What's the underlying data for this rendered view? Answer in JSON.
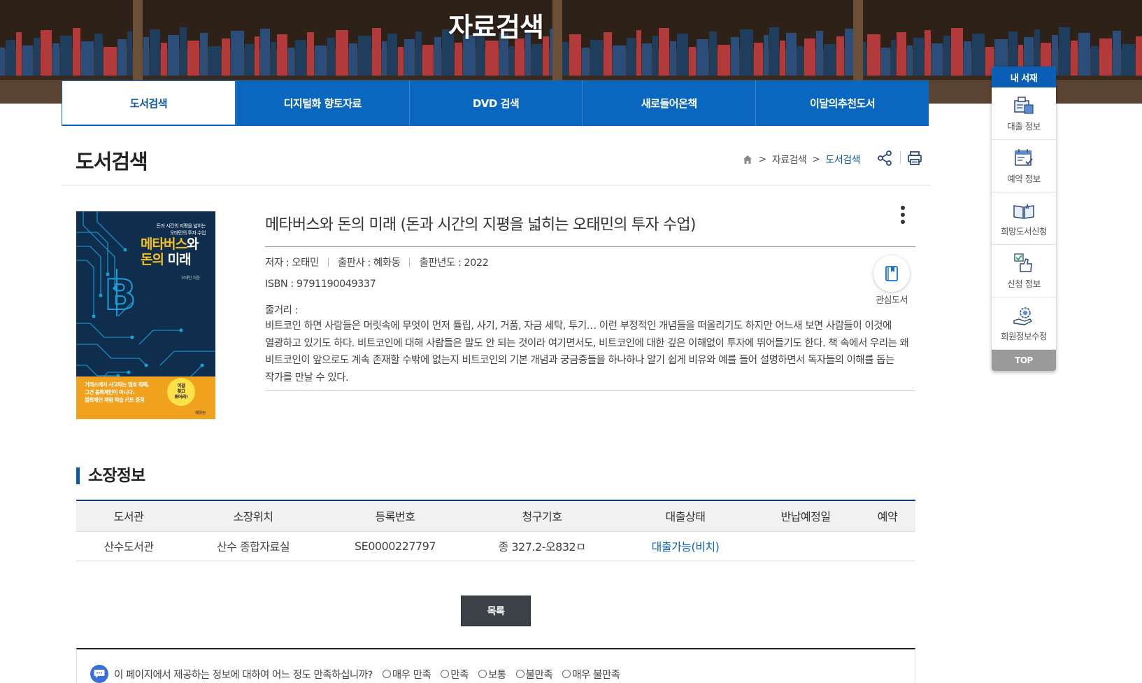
{
  "header": {
    "title": "자료검색"
  },
  "tabs": [
    {
      "label": "도서검색",
      "active": true
    },
    {
      "label": "디지털화 향토자료",
      "active": false
    },
    {
      "label": "DVD 검색",
      "active": false
    },
    {
      "label": "새로들어온책",
      "active": false
    },
    {
      "label": "이달의추천도서",
      "active": false
    }
  ],
  "page": {
    "title": "도서검색",
    "breadcrumb": [
      "자료검색",
      "도서검색"
    ],
    "breadcrumb_sep": ">"
  },
  "book": {
    "title": "메타버스와 돈의 미래 (돈과 시간의 지평을 넓히는 오태민의 투자 수업)",
    "author": "저자 : 오태민",
    "publisher": "출판사 : 혜화동",
    "year": "출판년도 : 2022",
    "isbn": "ISBN : 9791190049337",
    "summary_label": "줄거리 :",
    "summary": "비트코인 하면 사람들은 머릿속에 무엇이 먼저 튤립, 사기, 거품, 자금 세탁, 투기… 이런 부정적인 개념들을 떠올리기도 하지만 어느새 보면 사람들이 이것에 열광하고 있기도 하다. 비트코인에 대해 사람들은 말도 안 되는 것이라 여기면서도, 비트코인에 대한 깊은 이해없이 투자에 뛰어들기도 한다. 책 속에서 우리는 왜 비트코인이 앞으로도 계속 존재할 수밖에 없는지 비트코인의 기본 개념과 궁금증들을 하나하나 알기 쉽게 비유와 예를 들어 설명하면서 독자들의 이해를 돕는 작가를 만날 수 있다.",
    "favorite_label": "관심도서",
    "cover": {
      "top_text_1": "돈과 시간의 지평을 넓히는",
      "top_text_2": "오태민의 투자 수업",
      "title_1a": "메타버스",
      "title_1b": "와",
      "title_2a": "돈의",
      "title_2b": "미래",
      "author": "오태민 지음",
      "bottom_1": "거래소에서 사고파는 암호 화폐,",
      "bottom_2": "그건 블록체인이 아니다.",
      "bottom_3": "블록체인 채험 학습 키트 증정",
      "badge_1": "이걸",
      "badge_2": "찾고",
      "badge_3": "뛰어라!",
      "publisher": "혜화동"
    }
  },
  "holdings": {
    "section_title": "소장정보",
    "columns": [
      "도서관",
      "소장위치",
      "등록번호",
      "청구기호",
      "대출상태",
      "반납예정일",
      "예약"
    ],
    "rows": [
      {
        "library": "산수도서관",
        "location": "산수 종합자료실",
        "reg_no": "SE0000227797",
        "call_no": "종 327.2-오832ㅁ",
        "status": "대출가능(비치)",
        "due": "",
        "reserve": ""
      }
    ]
  },
  "list_button": "목록",
  "survey": {
    "question": "이 페이지에서 제공하는 정보에 대하여 어느 정도 만족하십니까?",
    "options": [
      "매우 만족",
      "만족",
      "보통",
      "불만족",
      "매우 불만족"
    ]
  },
  "quick_menu": {
    "title": "내 서재",
    "items": [
      "대출 정보",
      "예약 정보",
      "희망도서신청",
      "신청 정보",
      "회원정보수정"
    ],
    "top": "TOP"
  },
  "colors": {
    "primary": "#0a67bf",
    "status": "#0a64b7",
    "cover_bg": "#0d2a47",
    "cover_accent": "#f0a21e"
  }
}
